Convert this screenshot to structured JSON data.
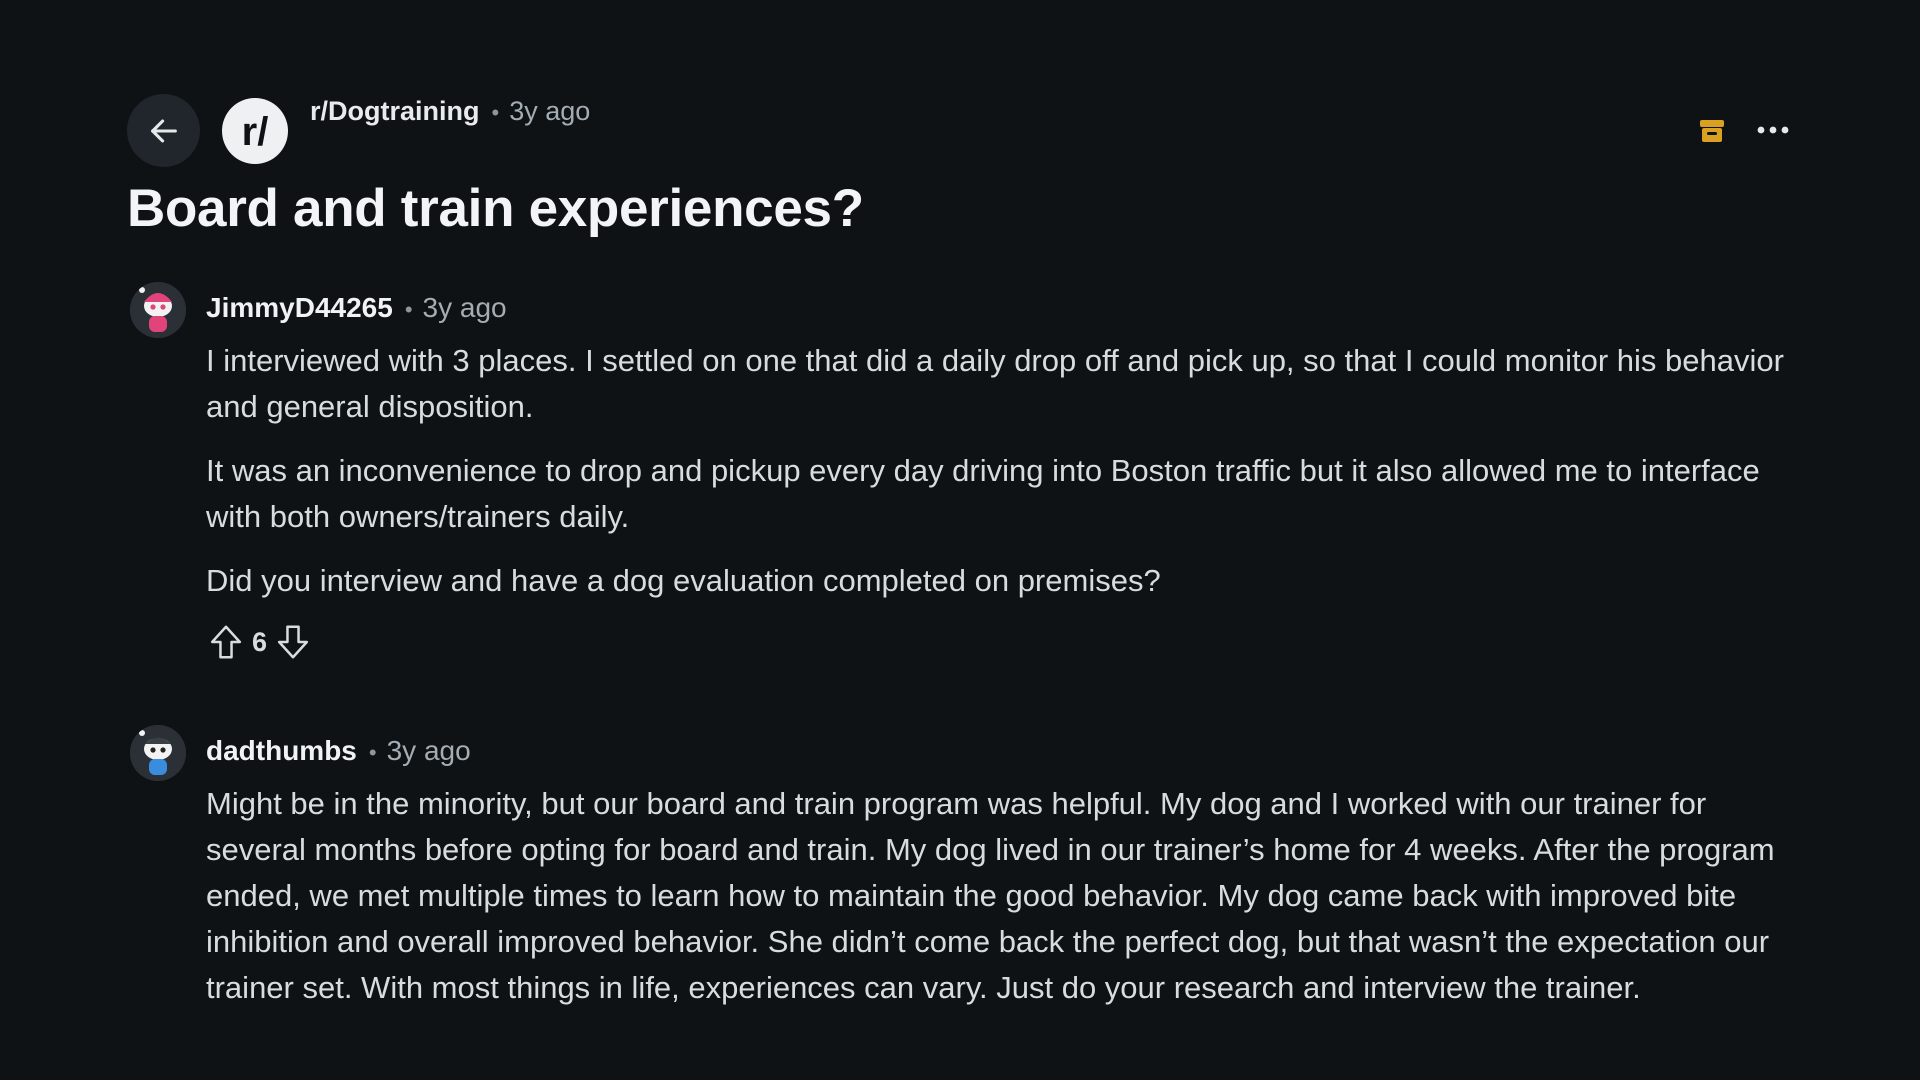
{
  "post": {
    "subreddit": "r/Dogtraining",
    "separator": "•",
    "age": "3y ago",
    "title": "Board and train experiences?",
    "subreddit_icon_text": "r/"
  },
  "icons": {
    "back": "arrow-left-icon",
    "archive": "archive-icon",
    "more": "more-horizontal-icon",
    "upvote": "arrow-up-icon",
    "downvote": "arrow-down-icon"
  },
  "colors": {
    "background": "#0e1215",
    "archive": "#d9a021",
    "avatar1_accent": "#e0447a",
    "avatar2_accent": "#3a8dde"
  },
  "comments": [
    {
      "user": "JimmyD44265",
      "separator": "•",
      "age": "3y ago",
      "paragraphs": [
        "I interviewed with 3 places. I settled on one that did a daily drop off and pick up, so that I could monitor his behavior and general disposition.",
        "It was an inconvenience to drop and pickup every day driving into Boston traffic but it also allowed me to interface with both owners/trainers daily.",
        "Did you interview and have a dog evaluation completed on premises?"
      ],
      "score": "6"
    },
    {
      "user": "dadthumbs",
      "separator": "•",
      "age": "3y ago",
      "paragraphs": [
        "Might be in the minority, but our board and train program was helpful. My dog and I worked with our trainer for several months before opting for board and train. My dog lived in our trainer’s home for 4 weeks. After the program ended, we met multiple times to learn how to maintain the good behavior. My dog came back with improved bite inhibition and overall improved behavior. She didn’t come back the perfect dog, but that wasn’t the expectation our trainer set. With most things in life, experiences can vary. Just do your research and interview the trainer."
      ]
    }
  ]
}
